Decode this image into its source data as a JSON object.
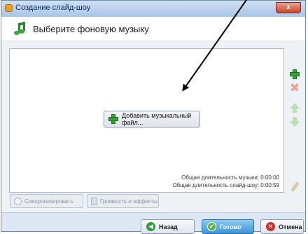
{
  "window": {
    "title": "Создание слайд-шоу",
    "close_label": "x"
  },
  "header": {
    "title": "Выберите фоновую музыку"
  },
  "list": {
    "add_file_label": "Добавить музыкальный файл...",
    "music_duration": "Общая длительность музыки: 0:00:00",
    "show_duration": "Общая длительность слайд-шоу: 0:00:59"
  },
  "side_toolbar": {
    "icons": [
      "add-icon",
      "delete-icon",
      "move-up-icon",
      "move-down-icon",
      "clear-icon"
    ]
  },
  "options": {
    "sync_label": "Синхронизировать",
    "volume_label": "Громкость и эффекты"
  },
  "footer": {
    "back_label": "Назад",
    "done_label": "Готово",
    "cancel_label": "Отмена"
  },
  "colors": {
    "window_frame": "#b9d1ea",
    "done_button": "#3f95d6",
    "add_green": "#3aa03a",
    "cancel_red": "#d0302a"
  }
}
